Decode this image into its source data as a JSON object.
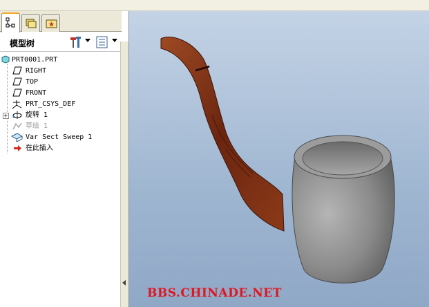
{
  "header": {
    "title": "模型树"
  },
  "tabs": [
    {
      "icon": "model-tree-icon",
      "active": true
    },
    {
      "icon": "folder-browser-icon",
      "active": false
    },
    {
      "icon": "favorites-icon",
      "active": false
    }
  ],
  "tree": {
    "root": "PRT0001.PRT",
    "items": [
      {
        "label": "RIGHT",
        "icon": "datum-plane-icon"
      },
      {
        "label": "TOP",
        "icon": "datum-plane-icon"
      },
      {
        "label": "FRONT",
        "icon": "datum-plane-icon"
      },
      {
        "label": "PRT_CSYS_DEF",
        "icon": "csys-icon"
      },
      {
        "label": "旋转 1",
        "icon": "revolve-icon"
      },
      {
        "label": "草绘 1",
        "icon": "sketch-icon"
      },
      {
        "label": "Var Sect Sweep 1",
        "icon": "sweep-icon"
      },
      {
        "label": "在此插入",
        "icon": "insert-here-arrow-icon"
      }
    ]
  },
  "watermark": "BBS.CHINADE.NET",
  "colors": {
    "tab_active_accent": "#f0a82a",
    "viewport_top": "#c4d3e6",
    "viewport_bottom": "#8fa8c6",
    "wood": "#7a2e14",
    "stone": "#8a8a8a",
    "watermark": "#e0161f"
  }
}
